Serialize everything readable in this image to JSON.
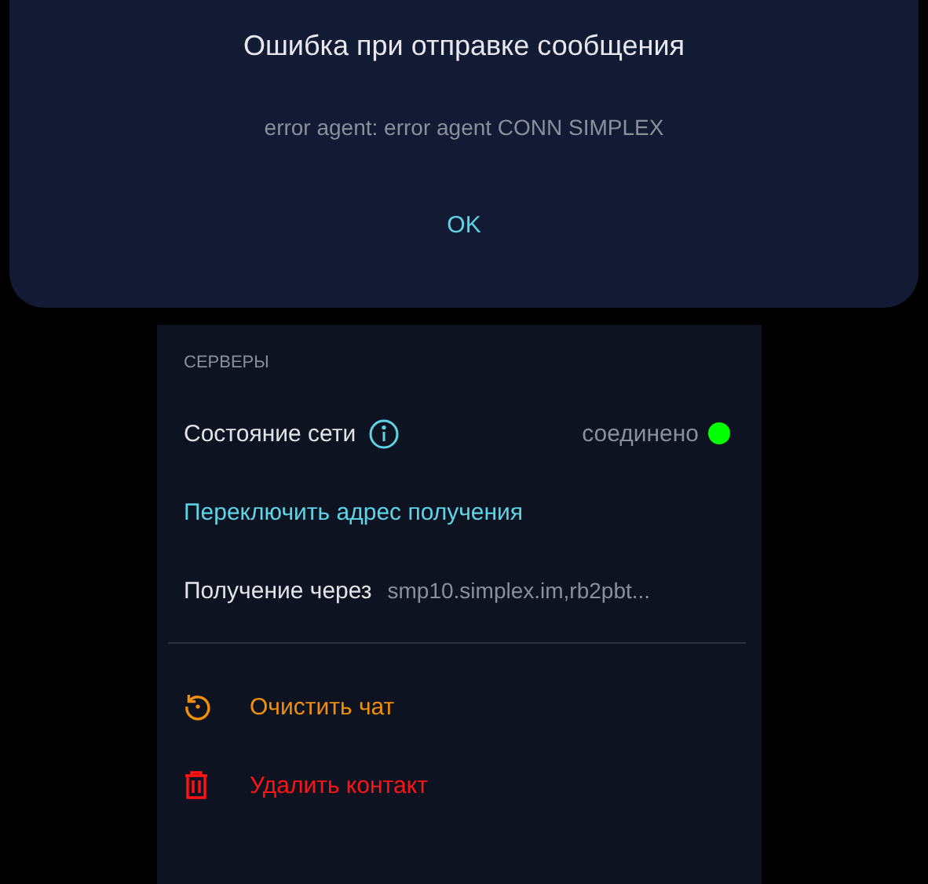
{
  "dialog": {
    "title": "Ошибка при отправке сообщения",
    "message": "error agent: error agent CONN SIMPLEX",
    "button": "OK"
  },
  "servers": {
    "header": "СЕРВЕРЫ",
    "network": {
      "label": "Состояние сети",
      "status": "соединено",
      "color": "#00ff00"
    },
    "switch_link": "Переключить адрес получения",
    "receive": {
      "label": "Получение через",
      "value": "smp10.simplex.im,rb2pbt..."
    }
  },
  "actions": [
    {
      "label": "Очистить чат",
      "kind": "clear"
    },
    {
      "label": "Удалить контакт",
      "kind": "delete"
    }
  ]
}
